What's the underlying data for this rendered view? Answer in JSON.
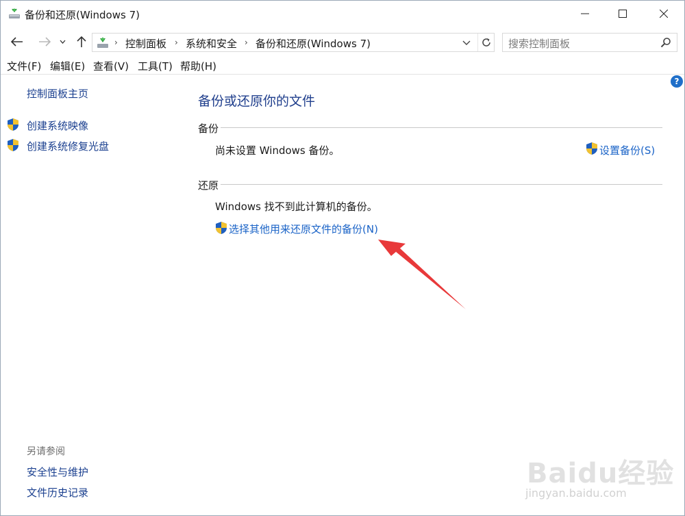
{
  "window": {
    "title": "备份和还原(Windows 7)",
    "controls": {
      "minimize": "minimize-icon",
      "maximize": "maximize-icon",
      "close": "close-icon"
    }
  },
  "address": {
    "breadcrumbs": [
      "控制面板",
      "系统和安全",
      "备份和还原(Windows 7)"
    ],
    "search_placeholder": "搜索控制面板"
  },
  "menu": [
    "文件(F)",
    "编辑(E)",
    "查看(V)",
    "工具(T)",
    "帮助(H)"
  ],
  "sidebar": {
    "home": "控制面板主页",
    "tasks": [
      {
        "label": "创建系统映像",
        "icon": "uac-shield-icon"
      },
      {
        "label": "创建系统修复光盘",
        "icon": "uac-shield-icon"
      }
    ],
    "see_also_heading": "另请参阅",
    "see_also": [
      "安全性与维护",
      "文件历史记录"
    ]
  },
  "main": {
    "title": "备份或还原你的文件",
    "backup": {
      "heading": "备份",
      "status": "尚未设置 Windows 备份。",
      "action": "设置备份(S)"
    },
    "restore": {
      "heading": "还原",
      "status": "Windows 找不到此计算机的备份。",
      "action": "选择其他用来还原文件的备份(N)"
    }
  },
  "help": {
    "label": "?"
  },
  "watermark": {
    "main": "Baidu经验",
    "sub": "jingyan.baidu.com"
  },
  "colors": {
    "link": "#1a63c7",
    "title": "#1f3e8c",
    "arrow": "#e8393a",
    "accent": "#1f6fc9"
  }
}
